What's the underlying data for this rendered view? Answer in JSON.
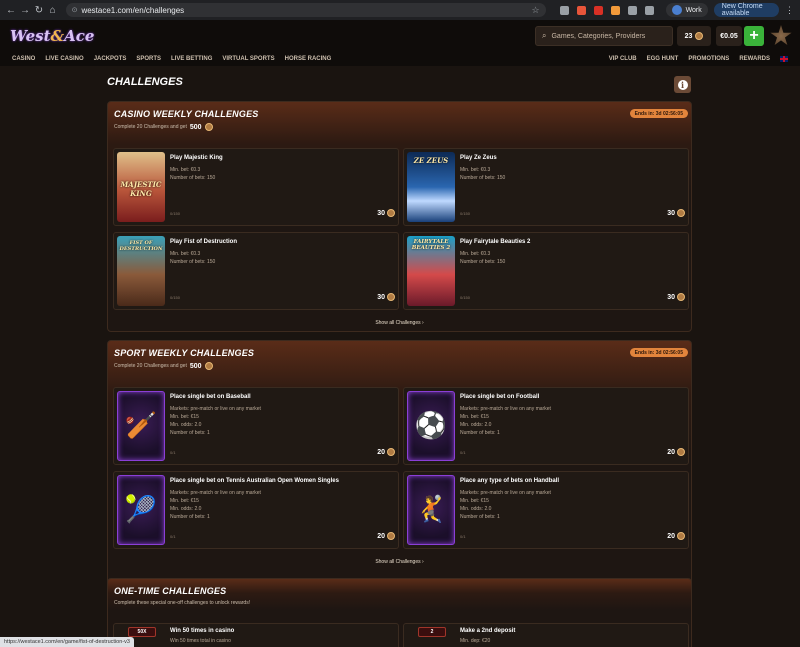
{
  "browser": {
    "url": "westace1.com/en/challenges",
    "profile": "Work",
    "update_label": "New Chrome available",
    "status_url": "https://westace1.com/en/game/fist-of-destruction-v3"
  },
  "header": {
    "logo_west": "West",
    "logo_amp": "&",
    "logo_ace": "Ace",
    "search_placeholder": "Games, Categories, Providers",
    "coins": "23",
    "balance": "€0.05",
    "plus": "+"
  },
  "nav": {
    "left": [
      "CASINO",
      "LIVE CASINO",
      "JACKPOTS",
      "SPORTS",
      "LIVE BETTING",
      "VIRTUAL SPORTS",
      "HORSE RACING"
    ],
    "right": [
      "VIP CLUB",
      "EGG HUNT",
      "PROMOTIONS",
      "REWARDS"
    ]
  },
  "page": {
    "title": "CHALLENGES",
    "info": "i"
  },
  "casino": {
    "title": "CASINO WEEKLY CHALLENGES",
    "subtitle": "Complete 20 Challenges and get",
    "reward": "500",
    "timer": "Ends in: 3d 02:56:05",
    "cards": [
      {
        "name": "Play Majestic King",
        "minbet": "Min. bet: €0.3",
        "bets": "Number of bets: 150",
        "progress": "0/150",
        "reward": "30",
        "thumb_title": "MAJESTIC KING"
      },
      {
        "name": "Play Ze Zeus",
        "minbet": "Min. bet: €0.3",
        "bets": "Number of bets: 150",
        "progress": "0/150",
        "reward": "30",
        "thumb_title": "ZE ZEUS"
      },
      {
        "name": "Play Fist of Destruction",
        "minbet": "Min. bet: €0.3",
        "bets": "Number of bets: 150",
        "progress": "0/150",
        "reward": "30",
        "thumb_title": "FIST OF DESTRUCTION"
      },
      {
        "name": "Play Fairytale Beauties 2",
        "minbet": "Min. bet: €0.3",
        "bets": "Number of bets: 150",
        "progress": "0/150",
        "reward": "30",
        "thumb_title": "FAIRYTALE BEAUTIES 2"
      }
    ],
    "show_all": "Show all Challenges"
  },
  "sport": {
    "title": "SPORT WEEKLY CHALLENGES",
    "subtitle": "Complete 20 Challenges and get",
    "reward": "500",
    "timer": "Ends in: 3d 02:56:05",
    "cards": [
      {
        "name": "Place single bet on Baseball",
        "markets": "Markets: pre-match or live on any market",
        "minbet": "Min. bet: €15",
        "odds": "Min. odds: 2.0",
        "bets": "Number of bets: 1",
        "progress": "0/1",
        "reward": "20",
        "glyph": "🏏"
      },
      {
        "name": "Place single bet on Football",
        "markets": "Markets: pre-match or live on any market",
        "minbet": "Min. bet: €15",
        "odds": "Min. odds: 2.0",
        "bets": "Number of bets: 1",
        "progress": "0/1",
        "reward": "20",
        "glyph": "⚽"
      },
      {
        "name": "Place single bet on Tennis Australian Open Women Singles",
        "markets": "Markets: pre-match or live on any market",
        "minbet": "Min. bet: €15",
        "odds": "Min. odds: 2.0",
        "bets": "Number of bets: 1",
        "progress": "0/1",
        "reward": "20",
        "glyph": "🎾"
      },
      {
        "name": "Place any type of bets on Handball",
        "markets": "Markets: pre-match or live on any market",
        "minbet": "Min. bet: €15",
        "odds": "Min. odds: 2.0",
        "bets": "Number of bets: 1",
        "progress": "0/1",
        "reward": "20",
        "glyph": "🤾"
      }
    ],
    "show_all": "Show all Challenges"
  },
  "onetime": {
    "title": "ONE-TIME CHALLENGES",
    "subtitle": "Complete these special one-off challenges to unlock rewards!",
    "cards": [
      {
        "badge": "50X",
        "name": "Win 50 times in casino",
        "detail": "Win 50 times total in casino"
      },
      {
        "badge": "2",
        "name": "Make a 2nd deposit",
        "detail": "Min. dep: €20"
      }
    ]
  }
}
